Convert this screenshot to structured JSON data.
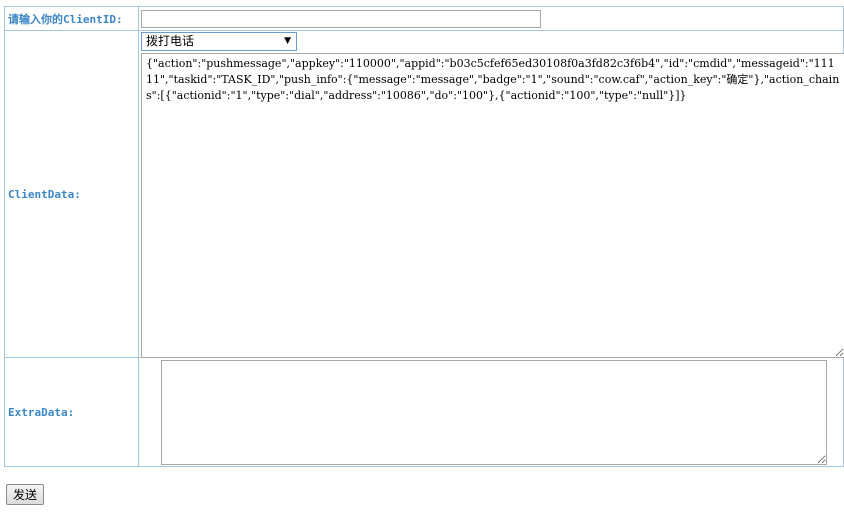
{
  "form": {
    "clientid_label": "请输入你的ClientID:",
    "clientid_value": "",
    "clientdata_label": "ClientData:",
    "clientdata_select_value": "拨打电话",
    "clientdata_value": "{\"action\":\"pushmessage\",\"appkey\":\"110000\",\"appid\":\"b03c5cfef65ed30108f0a3fd82c3f6b4\",\"id\":\"cmdid\",\"messageid\":\"11111\",\"taskid\":\"TASK_ID\",\"push_info\":{\"message\":\"message\",\"badge\":\"1\",\"sound\":\"cow.caf\",\"action_key\":\"确定\"},\"action_chains\":[{\"actionid\":\"1\",\"type\":\"dial\",\"address\":\"10086\",\"do\":\"100\"},{\"actionid\":\"100\",\"type\":\"null\"}]}",
    "extradata_label": "ExtraData:",
    "extradata_value": "",
    "send_label": "发送"
  },
  "icons": {
    "select_arrow": "chevron-down-icon"
  }
}
